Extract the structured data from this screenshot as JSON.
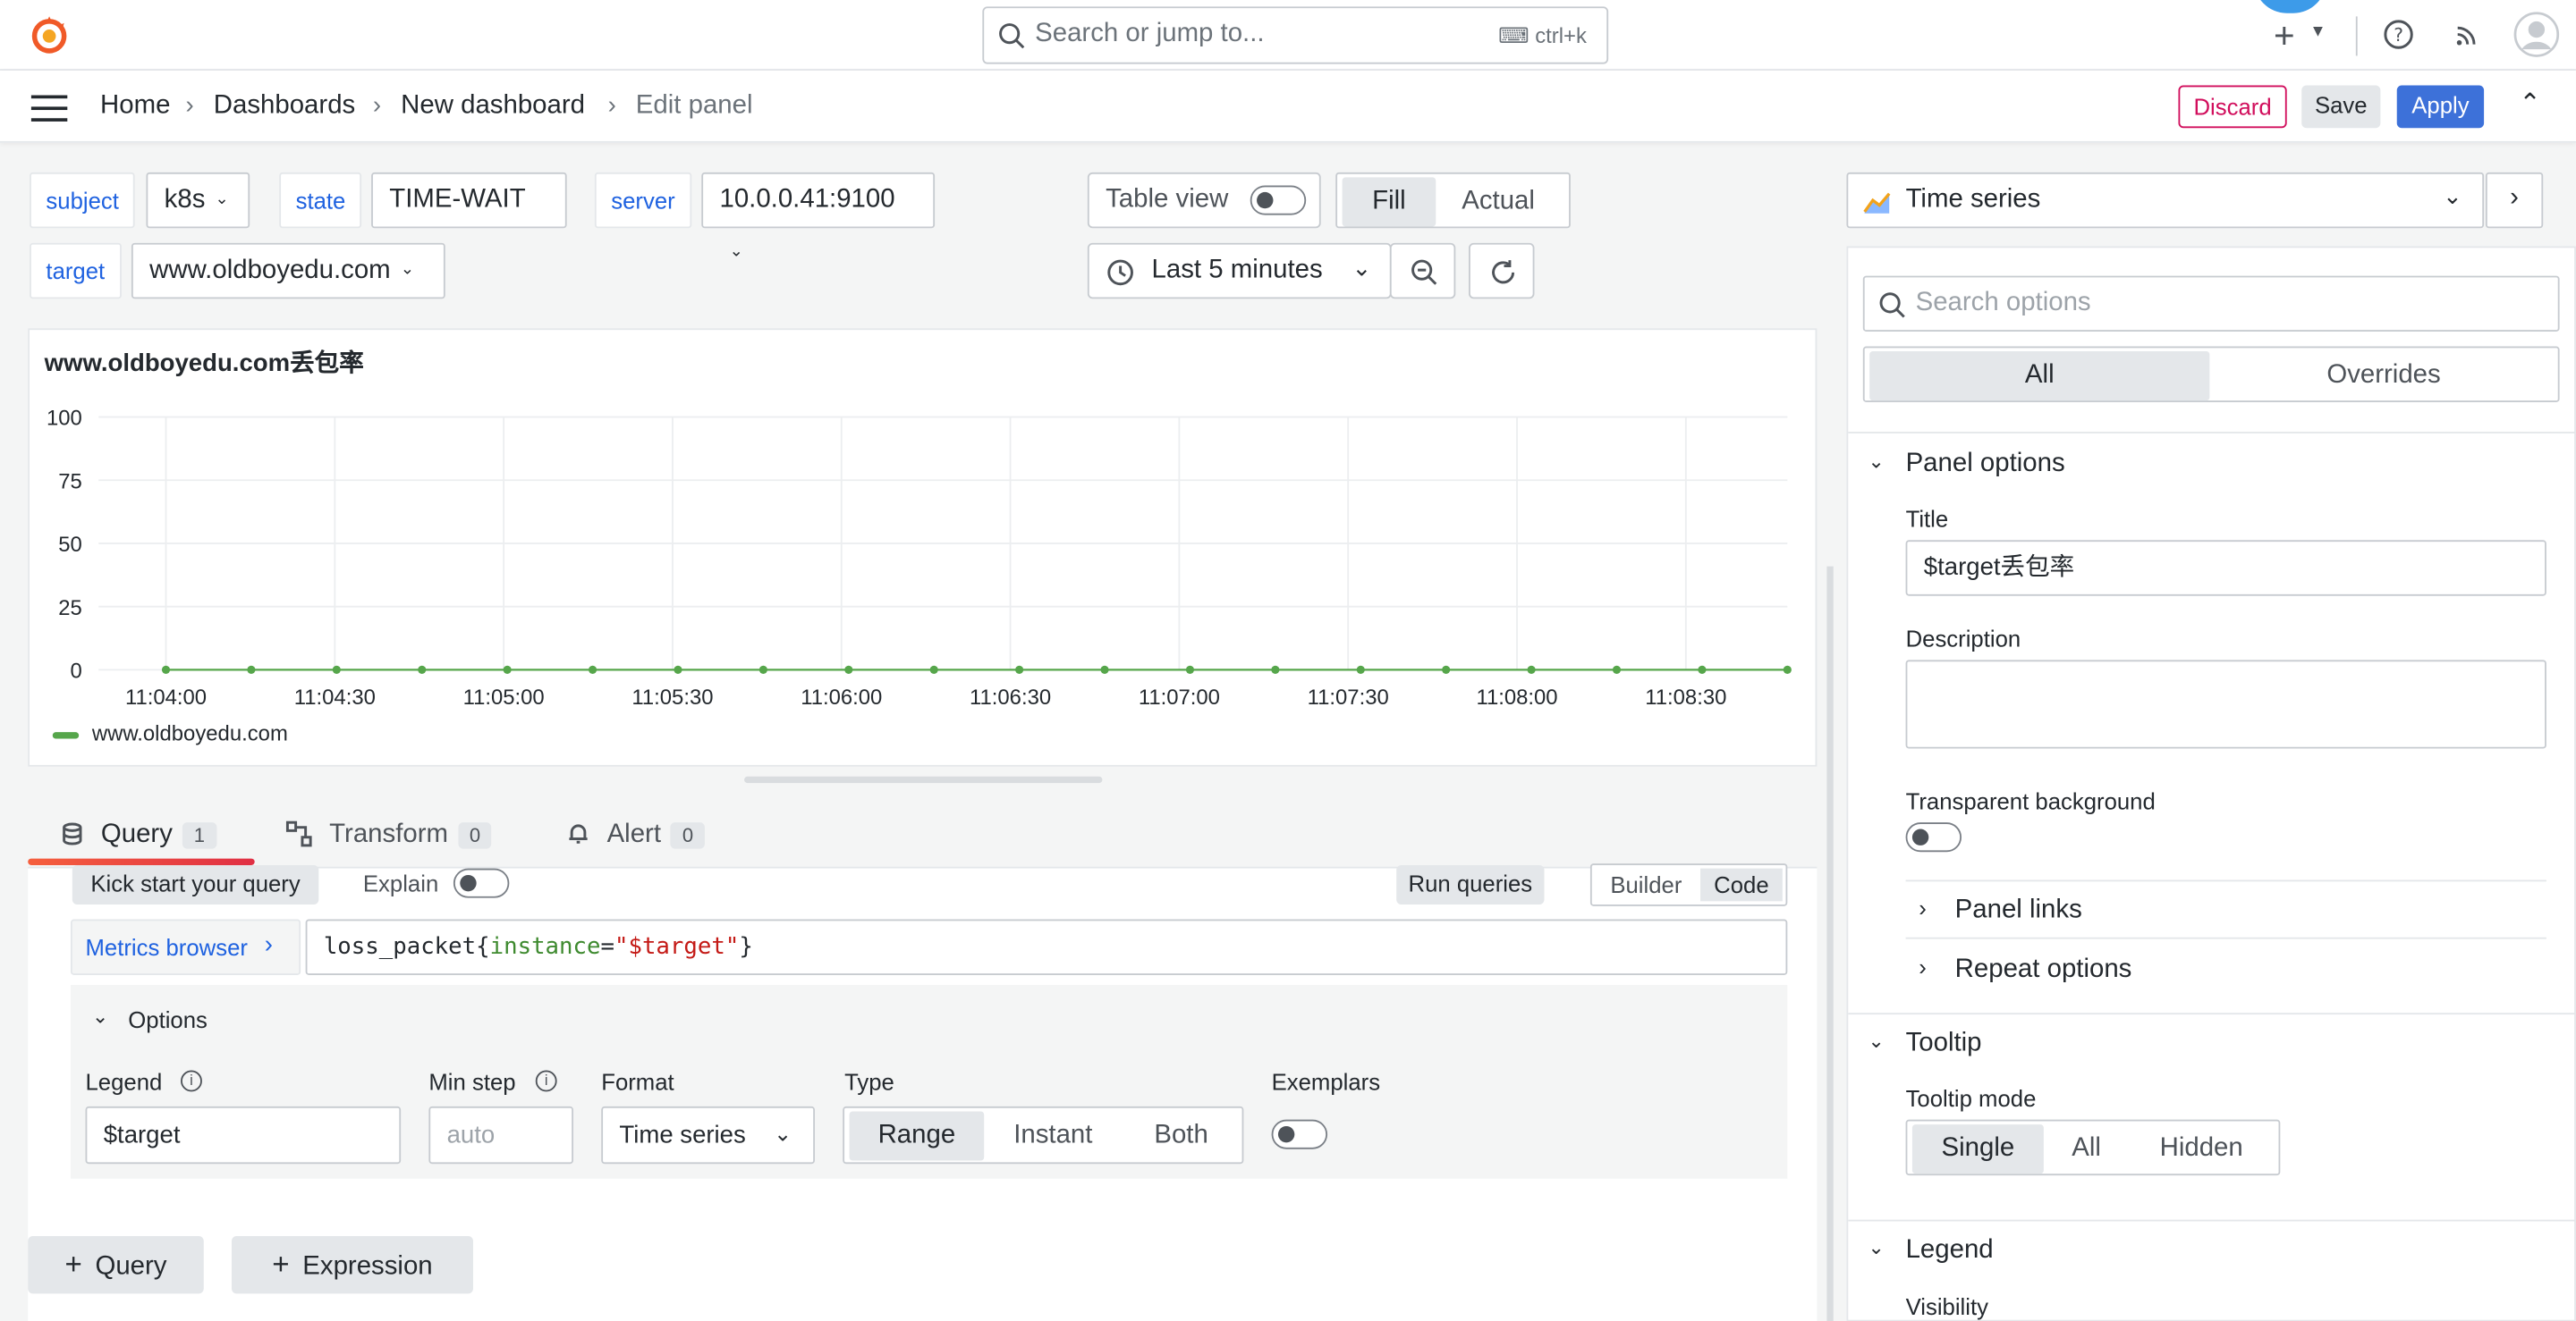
{
  "topbar": {
    "search_placeholder": "Search or jump to...",
    "search_shortcut": "ctrl+k"
  },
  "breadcrumb": {
    "items": [
      "Home",
      "Dashboards",
      "New dashboard",
      "Edit panel"
    ]
  },
  "actions": {
    "discard": "Discard",
    "save": "Save",
    "apply": "Apply"
  },
  "variables": [
    {
      "label": "subject",
      "value": "k8s"
    },
    {
      "label": "state",
      "value": "TIME-WAIT"
    },
    {
      "label": "server",
      "value": "10.0.0.41:9100"
    },
    {
      "label": "target",
      "value": "www.oldboyedu.com"
    }
  ],
  "view": {
    "table_view": "Table view",
    "fill": "Fill",
    "actual": "Actual",
    "time_range": "Last 5 minutes"
  },
  "chart_data": {
    "type": "line",
    "title": "www.oldboyedu.com丢包率",
    "x": [
      "11:04:00",
      "11:04:30",
      "11:05:00",
      "11:05:30",
      "11:06:00",
      "11:06:30",
      "11:07:00",
      "11:07:30",
      "11:08:00",
      "11:08:30"
    ],
    "y_ticks": [
      100,
      75,
      50,
      25,
      0
    ],
    "ylim": [
      0,
      100
    ],
    "grid": true,
    "legend_position": "bottom-left",
    "series": [
      {
        "name": "www.oldboyedu.com",
        "color": "#56a64b",
        "values": [
          0,
          0,
          0,
          0,
          0,
          0,
          0,
          0,
          0,
          0,
          0,
          0,
          0,
          0,
          0,
          0,
          0,
          0,
          0,
          0
        ]
      }
    ]
  },
  "query_tabs": [
    {
      "label": "Query",
      "count": "1"
    },
    {
      "label": "Transform",
      "count": "0"
    },
    {
      "label": "Alert",
      "count": "0"
    }
  ],
  "query": {
    "kick_start": "Kick start your query",
    "explain": "Explain",
    "run_queries": "Run queries",
    "builder": "Builder",
    "code": "Code",
    "metrics_browser": "Metrics browser",
    "expr_metric": "loss_packet{",
    "expr_label": "instance",
    "expr_eq": "=",
    "expr_value": "\"$target\"",
    "expr_close": "}",
    "options_title": "Options",
    "legend_label": "Legend",
    "legend_value": "$target",
    "min_step_label": "Min step",
    "min_step_placeholder": "auto",
    "format_label": "Format",
    "format_value": "Time series",
    "type_label": "Type",
    "type_options": [
      "Range",
      "Instant",
      "Both"
    ],
    "exemplars_label": "Exemplars",
    "add_query": "Query",
    "add_expression": "Expression"
  },
  "options_pane": {
    "viz_name": "Time series",
    "search_placeholder": "Search options",
    "tab_all": "All",
    "tab_overrides": "Overrides",
    "panel_options": "Panel options",
    "title_label": "Title",
    "title_value": "$target丢包率",
    "description_label": "Description",
    "transparent_label": "Transparent background",
    "panel_links": "Panel links",
    "repeat_options": "Repeat options",
    "tooltip": "Tooltip",
    "tooltip_mode_label": "Tooltip mode",
    "tooltip_modes": [
      "Single",
      "All",
      "Hidden"
    ],
    "legend": "Legend",
    "visibility": "Visibility"
  }
}
